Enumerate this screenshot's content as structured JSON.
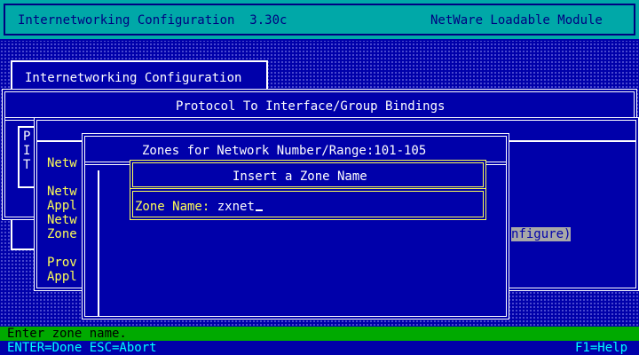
{
  "header": {
    "title": "Internetworking Configuration  3.30c",
    "module": "NetWare Loadable Module"
  },
  "main_menu": {
    "title": "Internetworking Configuration"
  },
  "bindings": {
    "title": "Protocol To Interface/Group Bindings",
    "left_letters": [
      "P",
      "I",
      "T"
    ]
  },
  "config_list": {
    "items": [
      "Netw",
      "Netw",
      "Appl",
      "Netw",
      "Zone",
      "Prov",
      "Appl"
    ],
    "highlight_text": "nfigure)"
  },
  "zones": {
    "title": "Zones for Network Number/Range:101-105"
  },
  "insert_dialog": {
    "title": "Insert a Zone Name",
    "field_label": "Zone Name:",
    "field_value": "zxnet"
  },
  "status": {
    "message": "Enter zone name."
  },
  "keys": {
    "left": "ENTER=Done ESC=Abort",
    "right": "F1=Help"
  },
  "colors": {
    "background_blue": "#0000aa",
    "header_cyan": "#00a8a8",
    "status_green": "#00aa00",
    "yellow_text": "#ffff55"
  }
}
